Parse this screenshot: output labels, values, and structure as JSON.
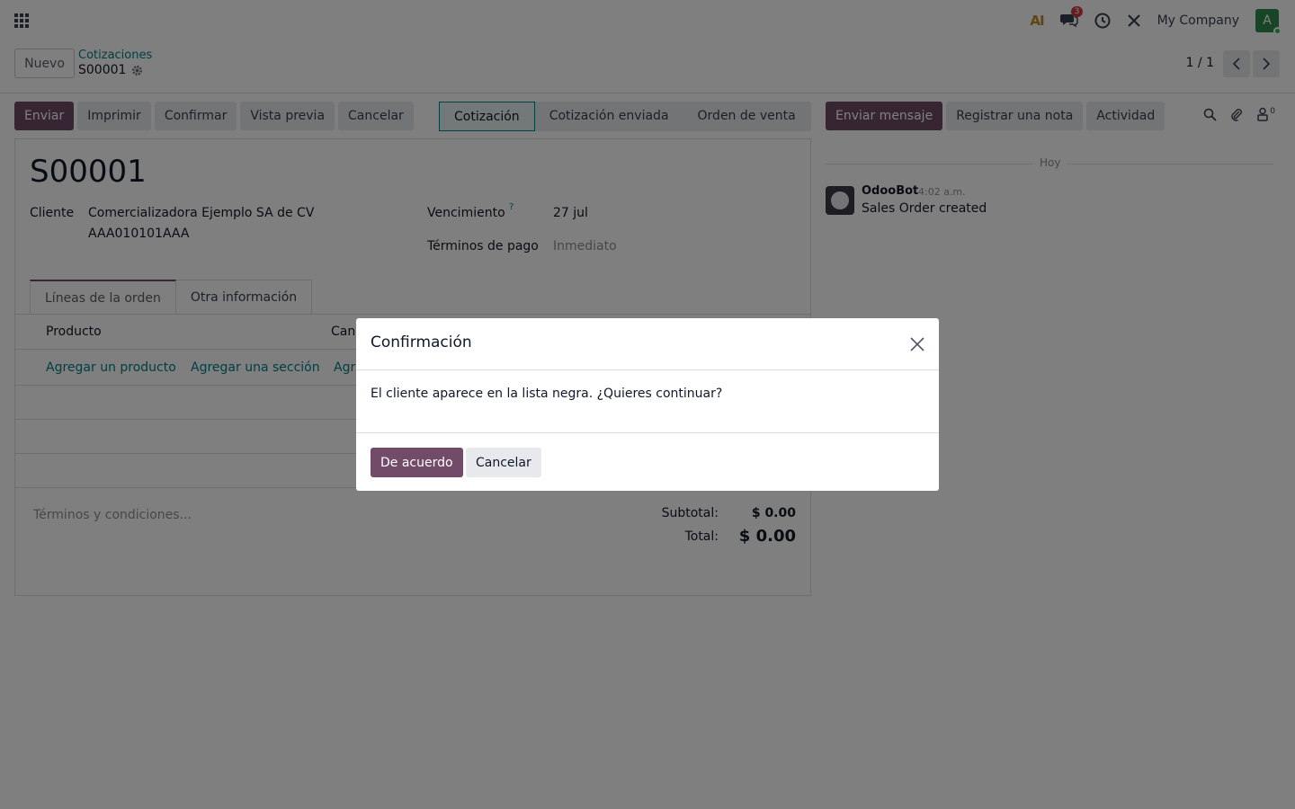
{
  "navbar": {
    "ai_label": "AI",
    "messages_count": "3",
    "company": "My Company",
    "avatar_initial": "A"
  },
  "control": {
    "new_button": "Nuevo",
    "breadcrumb": "Cotizaciones",
    "record": "S00001",
    "pager": "1 / 1"
  },
  "statusbar": {
    "buttons": [
      "Enviar",
      "Imprimir",
      "Confirmar",
      "Vista previa",
      "Cancelar"
    ],
    "stages": [
      "Cotización",
      "Cotización enviada",
      "Orden de venta"
    ]
  },
  "form": {
    "title": "S00001",
    "customer_label": "Cliente",
    "customer_name": "Comercializadora Ejemplo SA de CV",
    "customer_vat": "AAA010101AAA",
    "due_label": "Vencimiento",
    "due_help": "?",
    "due_value": "27 jul",
    "payment_terms_label": "Términos de pago",
    "payment_terms_placeholder": "Inmediato",
    "tabs": [
      "Líneas de la orden",
      "Otra información"
    ],
    "col_product": "Producto",
    "col_qty": "Can",
    "add_product": "Agregar un producto",
    "add_section": "Agregar una sección",
    "add_note": "Agr",
    "terms_placeholder": "Términos y condiciones...",
    "subtotal_label": "Subtotal:",
    "subtotal_value": "$ 0.00",
    "total_label": "Total:",
    "total_value": "$ 0.00"
  },
  "chatter": {
    "send_message": "Enviar mensaje",
    "log_note": "Registrar una nota",
    "activity": "Actividad",
    "followers_count": "0",
    "day": "Hoy",
    "author": "OdooBot",
    "time": "4:02 a.m.",
    "message": "Sales Order created"
  },
  "modal": {
    "title": "Confirmación",
    "body": "El cliente aparece en la lista negra. ¿Quieres continuar?",
    "ok": "De acuerdo",
    "cancel": "Cancelar"
  },
  "colors": {
    "primary": "#714b67",
    "link": "#017e84",
    "overlay": "rgba(0,0,0,0.5)"
  }
}
